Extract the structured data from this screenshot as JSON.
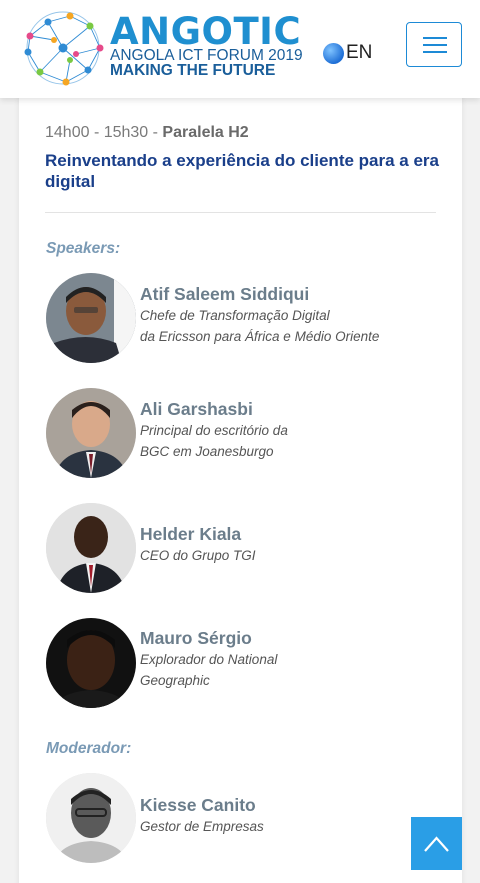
{
  "header": {
    "logo_word_a": "ANGO",
    "logo_word_b": "TIC",
    "logo_sub1": "ANGOLA ICT FORUM 2019",
    "logo_sub2": "MAKING THE FUTURE",
    "language": "EN",
    "menu_icon": "hamburger-icon"
  },
  "session": {
    "time": "14h00 - 15h30 - ",
    "room": "Paralela H2",
    "title": "Reinventando a experiência do cliente para a era digital"
  },
  "speakers_label": "Speakers:",
  "speakers": [
    {
      "name": "Atif Saleem Siddiqui",
      "role_line1": "Chefe de Transformação Digital",
      "role_line2": "da Ericsson para África e Médio Oriente"
    },
    {
      "name": "Ali Garshasbi",
      "role_line1": "Principal do escritório da",
      "role_line2": "BGC em Joanesburgo"
    },
    {
      "name": "Helder Kiala",
      "role_line1": "CEO do Grupo TGI",
      "role_line2": ""
    },
    {
      "name": "Mauro Sérgio",
      "role_line1": "Explorador do National",
      "role_line2": "Geographic"
    }
  ],
  "moderator_label": "Moderador:",
  "moderator": {
    "name": "Kiesse Canito",
    "role_line1": "Gestor de Empresas"
  },
  "colors": {
    "accent": "#1d8ad6",
    "title": "#1a3f8a",
    "top_button": "#2a9ee6"
  },
  "icons": {
    "language": "globe-icon",
    "scroll_top": "chevron-up-icon"
  }
}
